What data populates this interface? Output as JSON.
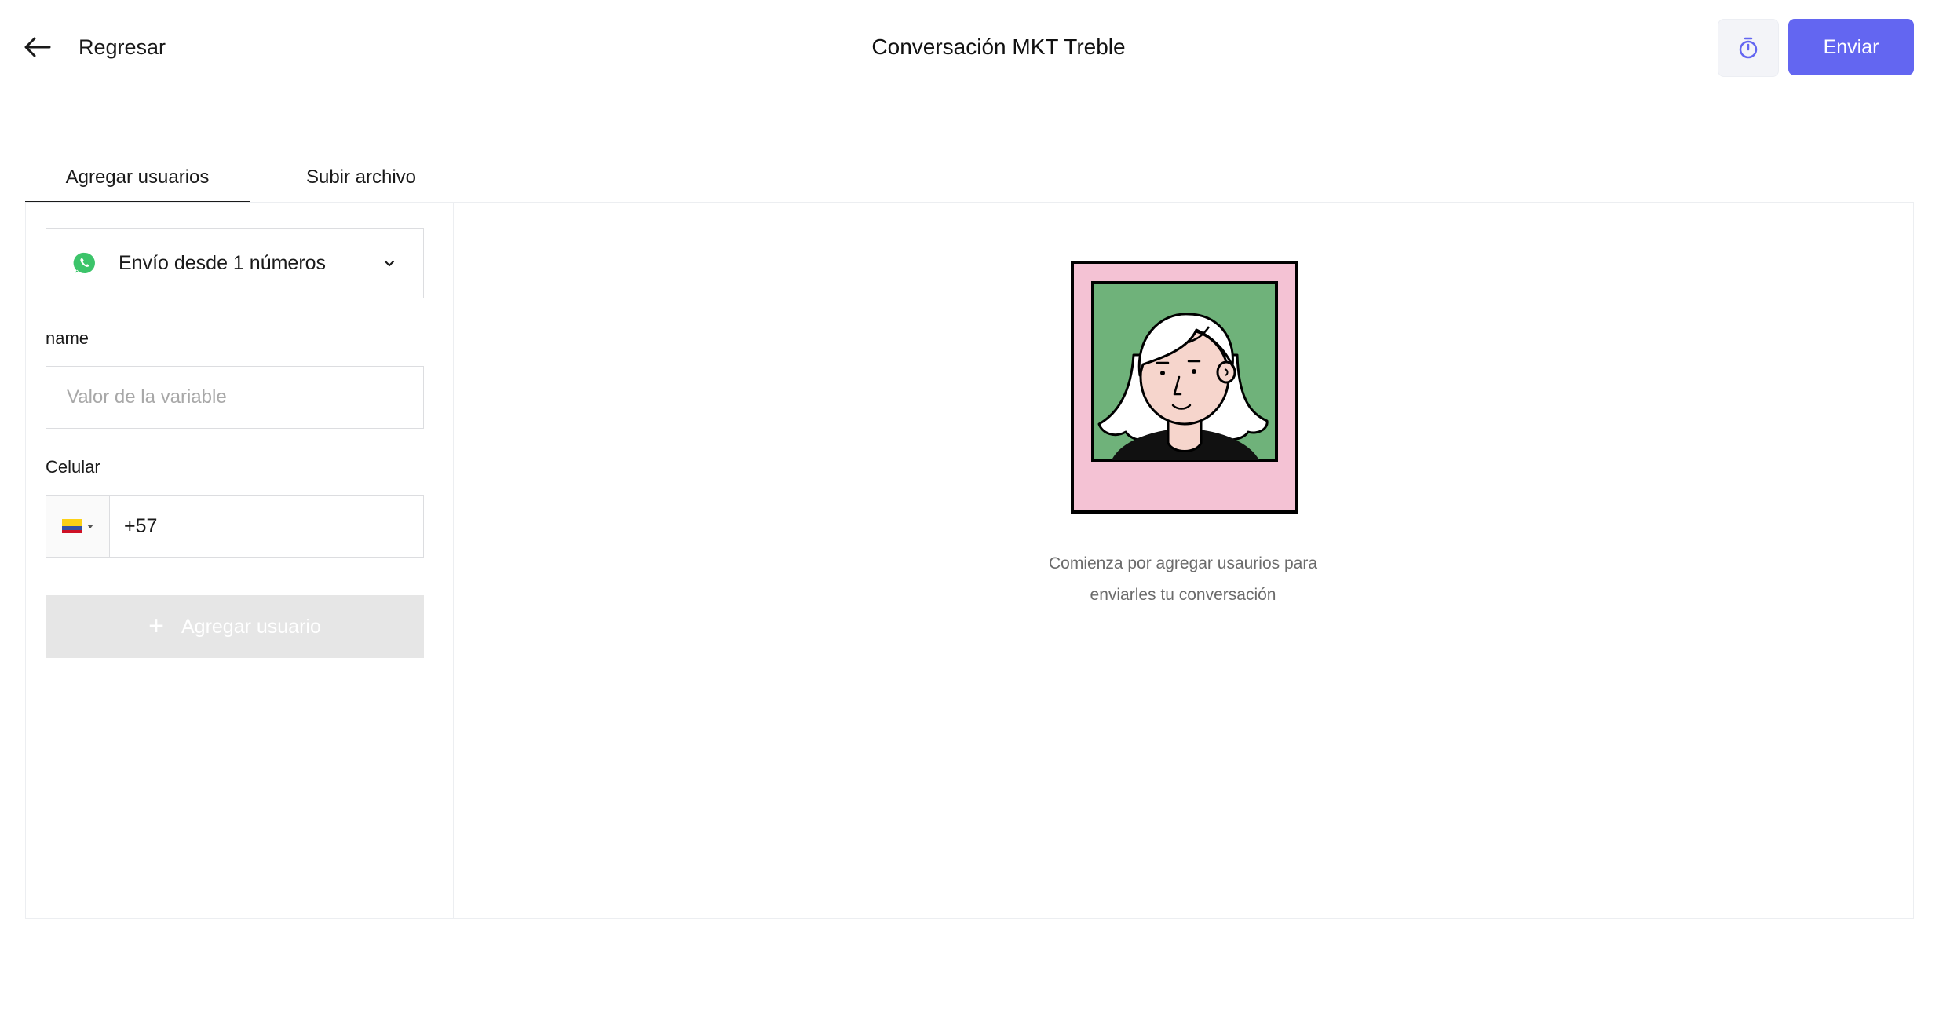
{
  "header": {
    "back_label": "Regresar",
    "title": "Conversación MKT Treble",
    "send_label": "Enviar",
    "accent_color": "#6366f1"
  },
  "tabs": [
    {
      "label": "Agregar usuarios",
      "active": true
    },
    {
      "label": "Subir archivo",
      "active": false
    }
  ],
  "form": {
    "sender": {
      "label": "Envío desde 1 números",
      "icon": "whatsapp-icon"
    },
    "variable": {
      "label": "name",
      "placeholder": "Valor de la variable",
      "value": ""
    },
    "phone": {
      "label": "Celular",
      "country": "Colombia",
      "value": "+57"
    },
    "add_user_label": "Agregar usuario"
  },
  "empty_state": {
    "line1": "Comienza por agregar usaurios para",
    "line2": "enviarles tu conversación"
  }
}
